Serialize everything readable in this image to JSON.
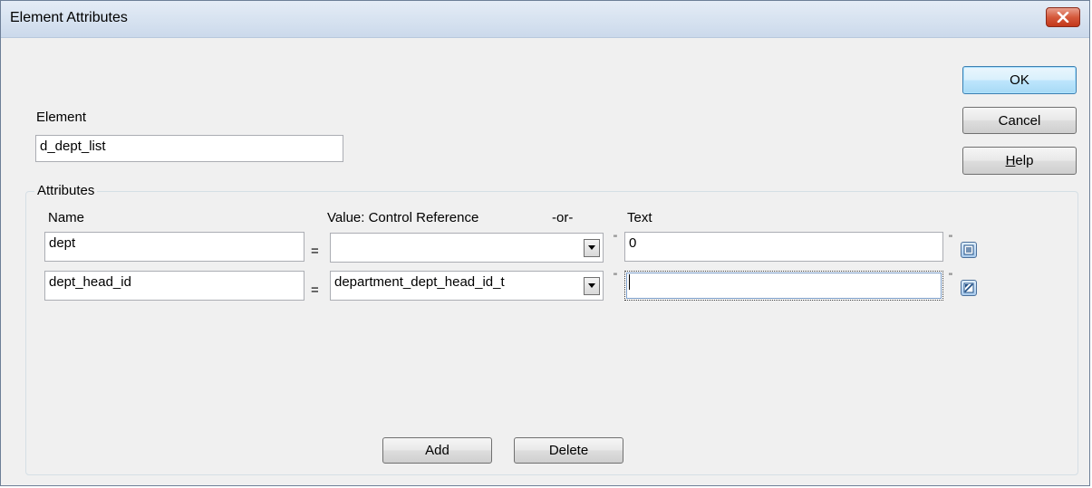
{
  "window": {
    "title": "Element Attributes",
    "close_icon": "close-icon"
  },
  "buttons": {
    "ok": "OK",
    "cancel": "Cancel",
    "help_accel": "H",
    "help_rest": "elp",
    "add": "Add",
    "delete": "Delete"
  },
  "element": {
    "label": "Element",
    "value": "d_dept_list"
  },
  "attributes": {
    "group_title": "Attributes",
    "headers": {
      "name": "Name",
      "value": "Value:  Control Reference",
      "or": "-or-",
      "text": "Text"
    },
    "rows": [
      {
        "name": "dept",
        "equals": "=",
        "control_ref": "",
        "quote_open": "\"",
        "text": "0",
        "quote_close": "\"",
        "side_icon": "expression-list-icon"
      },
      {
        "name": "dept_head_id",
        "equals": "=",
        "control_ref": "department_dept_head_id_t",
        "quote_open": "\"",
        "text": "",
        "quote_close": "\"",
        "side_icon": "expression-edit-icon"
      }
    ]
  },
  "colors": {
    "dialog_bg": "#f0f0f0",
    "titlebar": "#d9e4f1",
    "close_button": "#c3381a",
    "default_button_border": "#3c7fb1"
  }
}
